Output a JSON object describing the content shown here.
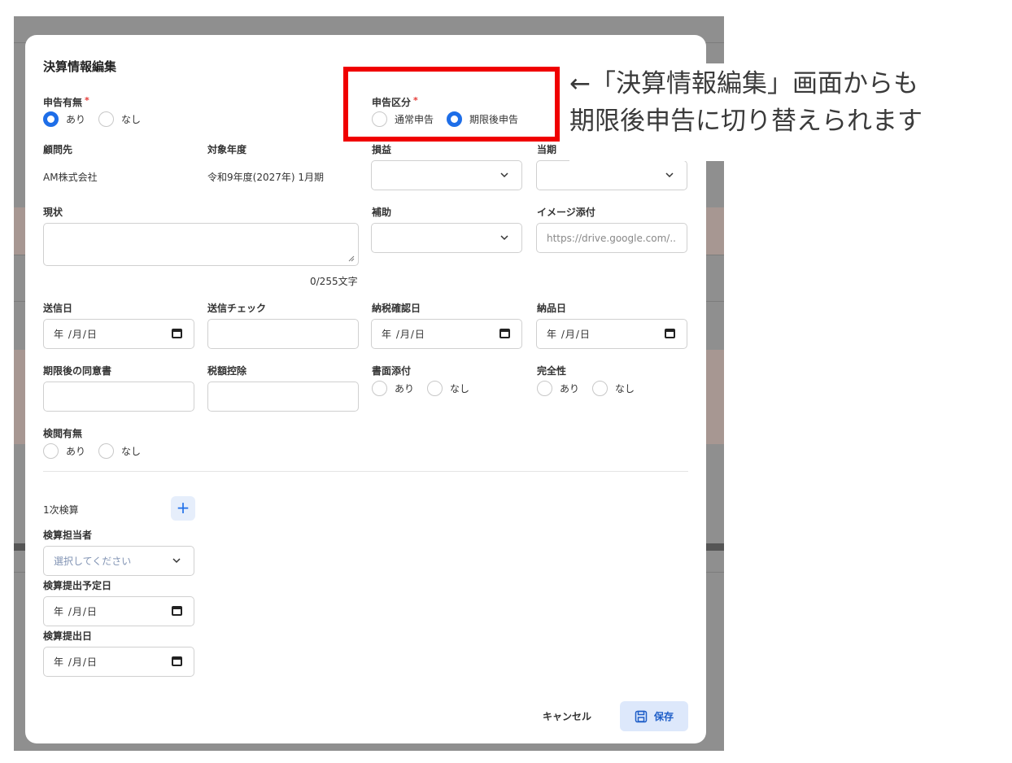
{
  "modal": {
    "title": "決算情報編集",
    "declaration": {
      "label": "申告有無",
      "options": [
        "あり",
        "なし"
      ],
      "selected": "あり"
    },
    "declaration_type": {
      "label": "申告区分",
      "options": [
        "通常申告",
        "期限後申告"
      ],
      "selected": "期限後申告"
    },
    "client": {
      "label": "顧問先",
      "value": "AM株式会社"
    },
    "fiscal_year": {
      "label": "対象年度",
      "value": "令和9年度(2027年) 1月期"
    },
    "profit_loss": {
      "label": "損益",
      "value": ""
    },
    "current_period": {
      "label": "当期",
      "value": ""
    },
    "status": {
      "label": "現状",
      "value": "",
      "counter": "0/255文字"
    },
    "assist": {
      "label": "補助",
      "value": ""
    },
    "image_attach": {
      "label": "イメージ添付",
      "placeholder": "https://drive.google.com/.."
    },
    "send_date": {
      "label": "送信日",
      "value": "年 /月/日"
    },
    "send_check": {
      "label": "送信チェック",
      "value": ""
    },
    "tax_confirm_date": {
      "label": "納税確認日",
      "value": "年 /月/日"
    },
    "delivery_date": {
      "label": "納品日",
      "value": "年 /月/日"
    },
    "late_consent": {
      "label": "期限後の同意書",
      "value": ""
    },
    "tax_deduction": {
      "label": "税額控除",
      "value": ""
    },
    "document_attach": {
      "label": "書面添付",
      "options": [
        "あり",
        "なし"
      ],
      "selected": ""
    },
    "completeness": {
      "label": "完全性",
      "options": [
        "あり",
        "なし"
      ],
      "selected": ""
    },
    "inspection": {
      "label": "検閲有無",
      "options": [
        "あり",
        "なし"
      ],
      "selected": ""
    },
    "review": {
      "section_label": "1次検算",
      "add_label": "+",
      "reviewer": {
        "label": "検算担当者",
        "placeholder": "選択してください"
      },
      "planned_date": {
        "label": "検算提出予定日",
        "value": "年 /月/日"
      },
      "submit_date": {
        "label": "検算提出日",
        "value": "年 /月/日"
      }
    },
    "buttons": {
      "cancel": "キャンセル",
      "save": "保存"
    }
  },
  "annotation": {
    "line1": "←「決算情報編集」画面からも",
    "line2": "期限後申告に切り替えられます"
  },
  "colors": {
    "accent": "#1e6ee8",
    "highlight": "#f00000",
    "required": "#e53935"
  }
}
